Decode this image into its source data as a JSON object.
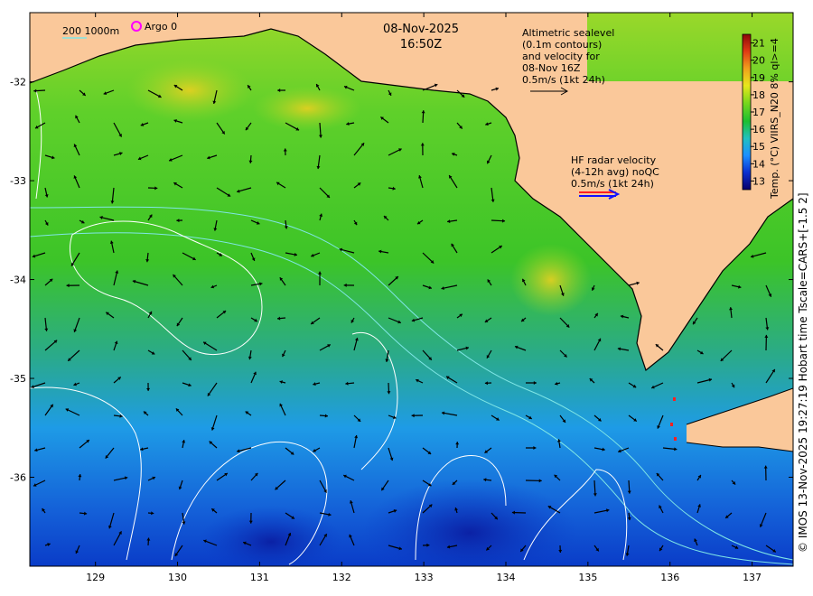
{
  "header": {
    "date": "08-Nov-2025",
    "time": "16:50Z"
  },
  "legend": {
    "depth_label": "200  1000m",
    "argo_label": "Argo 0"
  },
  "altimetry_note": {
    "lines": [
      "Altimetric sealevel",
      "(0.1m contours)",
      "and velocity for",
      "08-Nov 16Z",
      "0.5m/s (1kt 24h)"
    ]
  },
  "hf_radar_note": {
    "lines": [
      "HF radar velocity",
      "(4-12h avg) noQC",
      "0.5m/s (1kt 24h)"
    ]
  },
  "axes": {
    "x_ticks": [
      "129",
      "130",
      "131",
      "132",
      "133",
      "134",
      "135",
      "136",
      "137"
    ],
    "y_ticks": [
      "-32",
      "-33",
      "-34",
      "-35",
      "-36"
    ],
    "x_range": [
      128.2,
      137.5
    ],
    "y_range": [
      -36.9,
      -31.3
    ]
  },
  "colorbar": {
    "label": "Temp. (°C) VIIRS_N20 8% ql>=4",
    "ticks": [
      "21",
      "20",
      "19",
      "18",
      "17",
      "16",
      "15",
      "14",
      "13"
    ],
    "range": [
      12.5,
      21.5
    ],
    "colors": [
      "#08006a",
      "#0a2fd0",
      "#1e90ff",
      "#20c0c0",
      "#1cbf30",
      "#7ad81c",
      "#e8e81c",
      "#f0a01c",
      "#e03a14",
      "#8c0808"
    ]
  },
  "side_caption": "© IMOS 13-Nov-2025 19:27:19 Hobart time Tscale=CARS+[-1.5 2]",
  "colors": {
    "land": "#fac89a",
    "sea_green": "#3cc828",
    "sea_blue": "#1e9be6",
    "sea_deep": "#0a3cc8",
    "contour": "#ffffff",
    "isobath": "#7fe6e6",
    "argo": "#ff00ff",
    "radar_red": "#ff2020",
    "radar_blue": "#1010ff"
  }
}
